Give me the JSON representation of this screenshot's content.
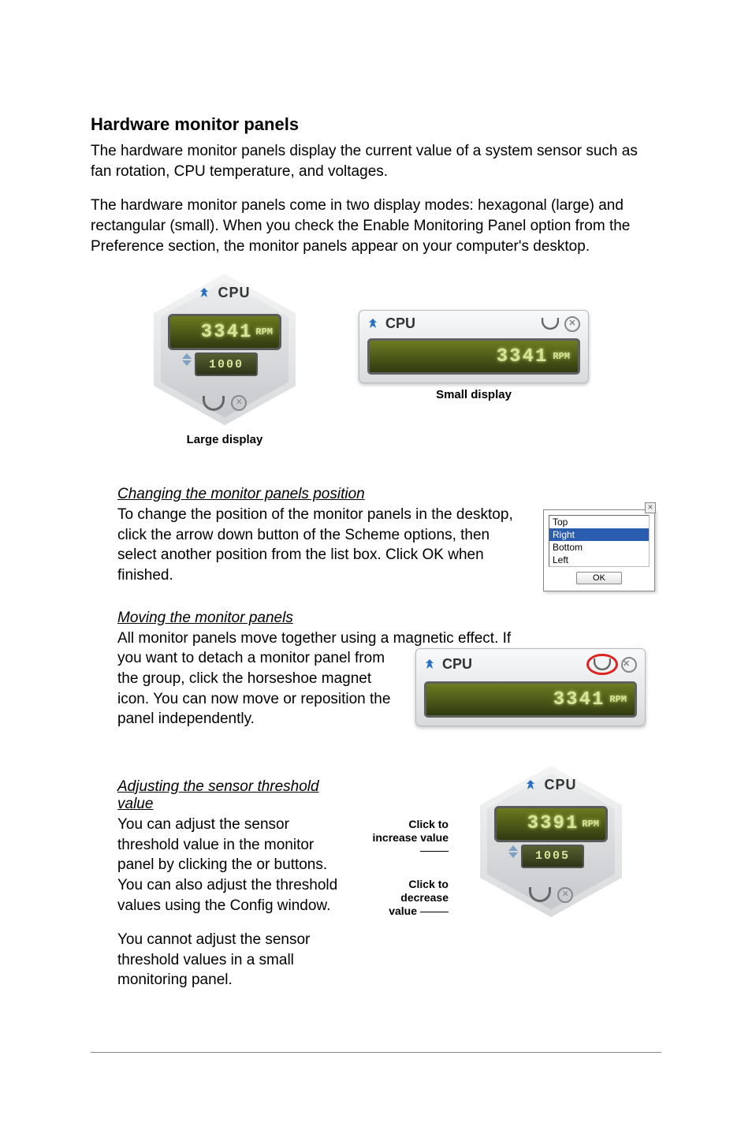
{
  "heading": "Hardware monitor panels",
  "para1": "The hardware monitor panels display the current value of a system sensor such as fan rotation, CPU temperature, and voltages.",
  "para2": "The hardware monitor panels come in two display modes: hexagonal (large) and rectangular (small). When you check the Enable Monitoring Panel option from the Preference section, the monitor panels appear on your computer's desktop.",
  "large_caption": "Large display",
  "small_caption": "Small display",
  "panel": {
    "title": "CPU",
    "value": "3341",
    "unit": "RPM",
    "threshold": "1000"
  },
  "panel_adjust": {
    "title": "CPU",
    "value": "3391",
    "unit": "RPM",
    "threshold": "1005"
  },
  "sec1_head": "Changing the monitor panels position",
  "sec1_body": "To change the position of the monitor panels in the desktop, click the arrow down button of the Scheme options, then select another position from the list box. Click OK when finished.",
  "sec2_head": "Moving the monitor panels",
  "sec2_body_a": "All monitor panels move together using a magnetic effect. If",
  "sec2_body_b": "you want to detach a monitor panel from the group, click the horseshoe magnet icon. You can now move or reposition the panel independently.",
  "sec3_head": "Adjusting the sensor threshold value",
  "sec3_body1": "You can adjust the sensor threshold value in the monitor panel by clicking the  or  buttons. You can also adjust the threshold values using the Config window.",
  "sec3_body2": "You cannot adjust the sensor threshold values in a small monitoring panel.",
  "position_options": {
    "o0": "Top",
    "o1": "Right",
    "o2": "Bottom",
    "o3": "Left"
  },
  "ok_label": "OK",
  "callout_inc": "Click to increase value",
  "callout_dec": "Click to decrease value"
}
